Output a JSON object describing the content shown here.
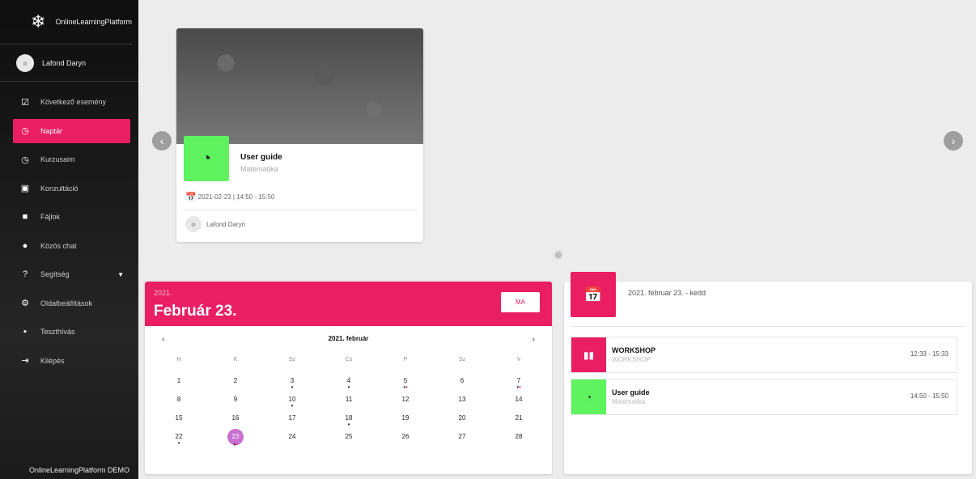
{
  "app": {
    "name": "OnlineLearningPlatform",
    "footer": "OnlineLearningPlatform DEMO"
  },
  "user": {
    "name": "Lafond Daryn"
  },
  "menu": [
    {
      "label": "Következő esemény",
      "icon": "calendar-check-icon"
    },
    {
      "label": "Naptár",
      "icon": "clock-icon",
      "active": true
    },
    {
      "label": "Kurzusaim",
      "icon": "clock-icon"
    },
    {
      "label": "Konzultáció",
      "icon": "clipboard-icon"
    },
    {
      "label": "Fájlok",
      "icon": "file-icon"
    },
    {
      "label": "Közös chat",
      "icon": "chat-icon"
    },
    {
      "label": "Segítség",
      "icon": "help-icon"
    },
    {
      "label": "Oldalbeállítások",
      "icon": "settings-icon"
    },
    {
      "label": "Teszthívás",
      "icon": "video-icon"
    },
    {
      "label": "Kilépés",
      "icon": "logout-icon"
    }
  ],
  "event_card": {
    "title": "User guide",
    "subject": "Matematika",
    "datetime": "2021-02-23 | 14:50 - 15:50",
    "owner": "Lafond Daryn",
    "icon_color": "#5ff35f"
  },
  "calendar": {
    "year": "2021.",
    "date": "Február 23.",
    "today_button": "MA",
    "month": "2021. február",
    "prev": "‹",
    "next": "›",
    "weekdays": [
      "H",
      "K",
      "Sz",
      "Cs",
      "P",
      "Sz",
      "V"
    ],
    "weeks": [
      [
        "1",
        "2",
        "3",
        "4",
        "5",
        "6",
        "7"
      ],
      [
        "8",
        "9",
        "10",
        "11",
        "12",
        "13",
        "14"
      ],
      [
        "15",
        "16",
        "17",
        "18",
        "19",
        "20",
        "21"
      ],
      [
        "22",
        "23",
        "24",
        "25",
        "26",
        "27",
        "28"
      ]
    ],
    "selected": "23",
    "accent": "#e91e63"
  },
  "day_list": {
    "date": "2021. február 23. - kedd",
    "items": [
      {
        "title": "WORKSHOP",
        "subtitle": "WORKSHOP",
        "time": "12:33 - 15:33",
        "color": "#e91e63",
        "icon": "book-icon"
      },
      {
        "title": "User guide",
        "subtitle": "Matematika",
        "time": "14:50 - 15:50",
        "color": "#5ff35f",
        "icon": "timer-icon"
      }
    ]
  }
}
